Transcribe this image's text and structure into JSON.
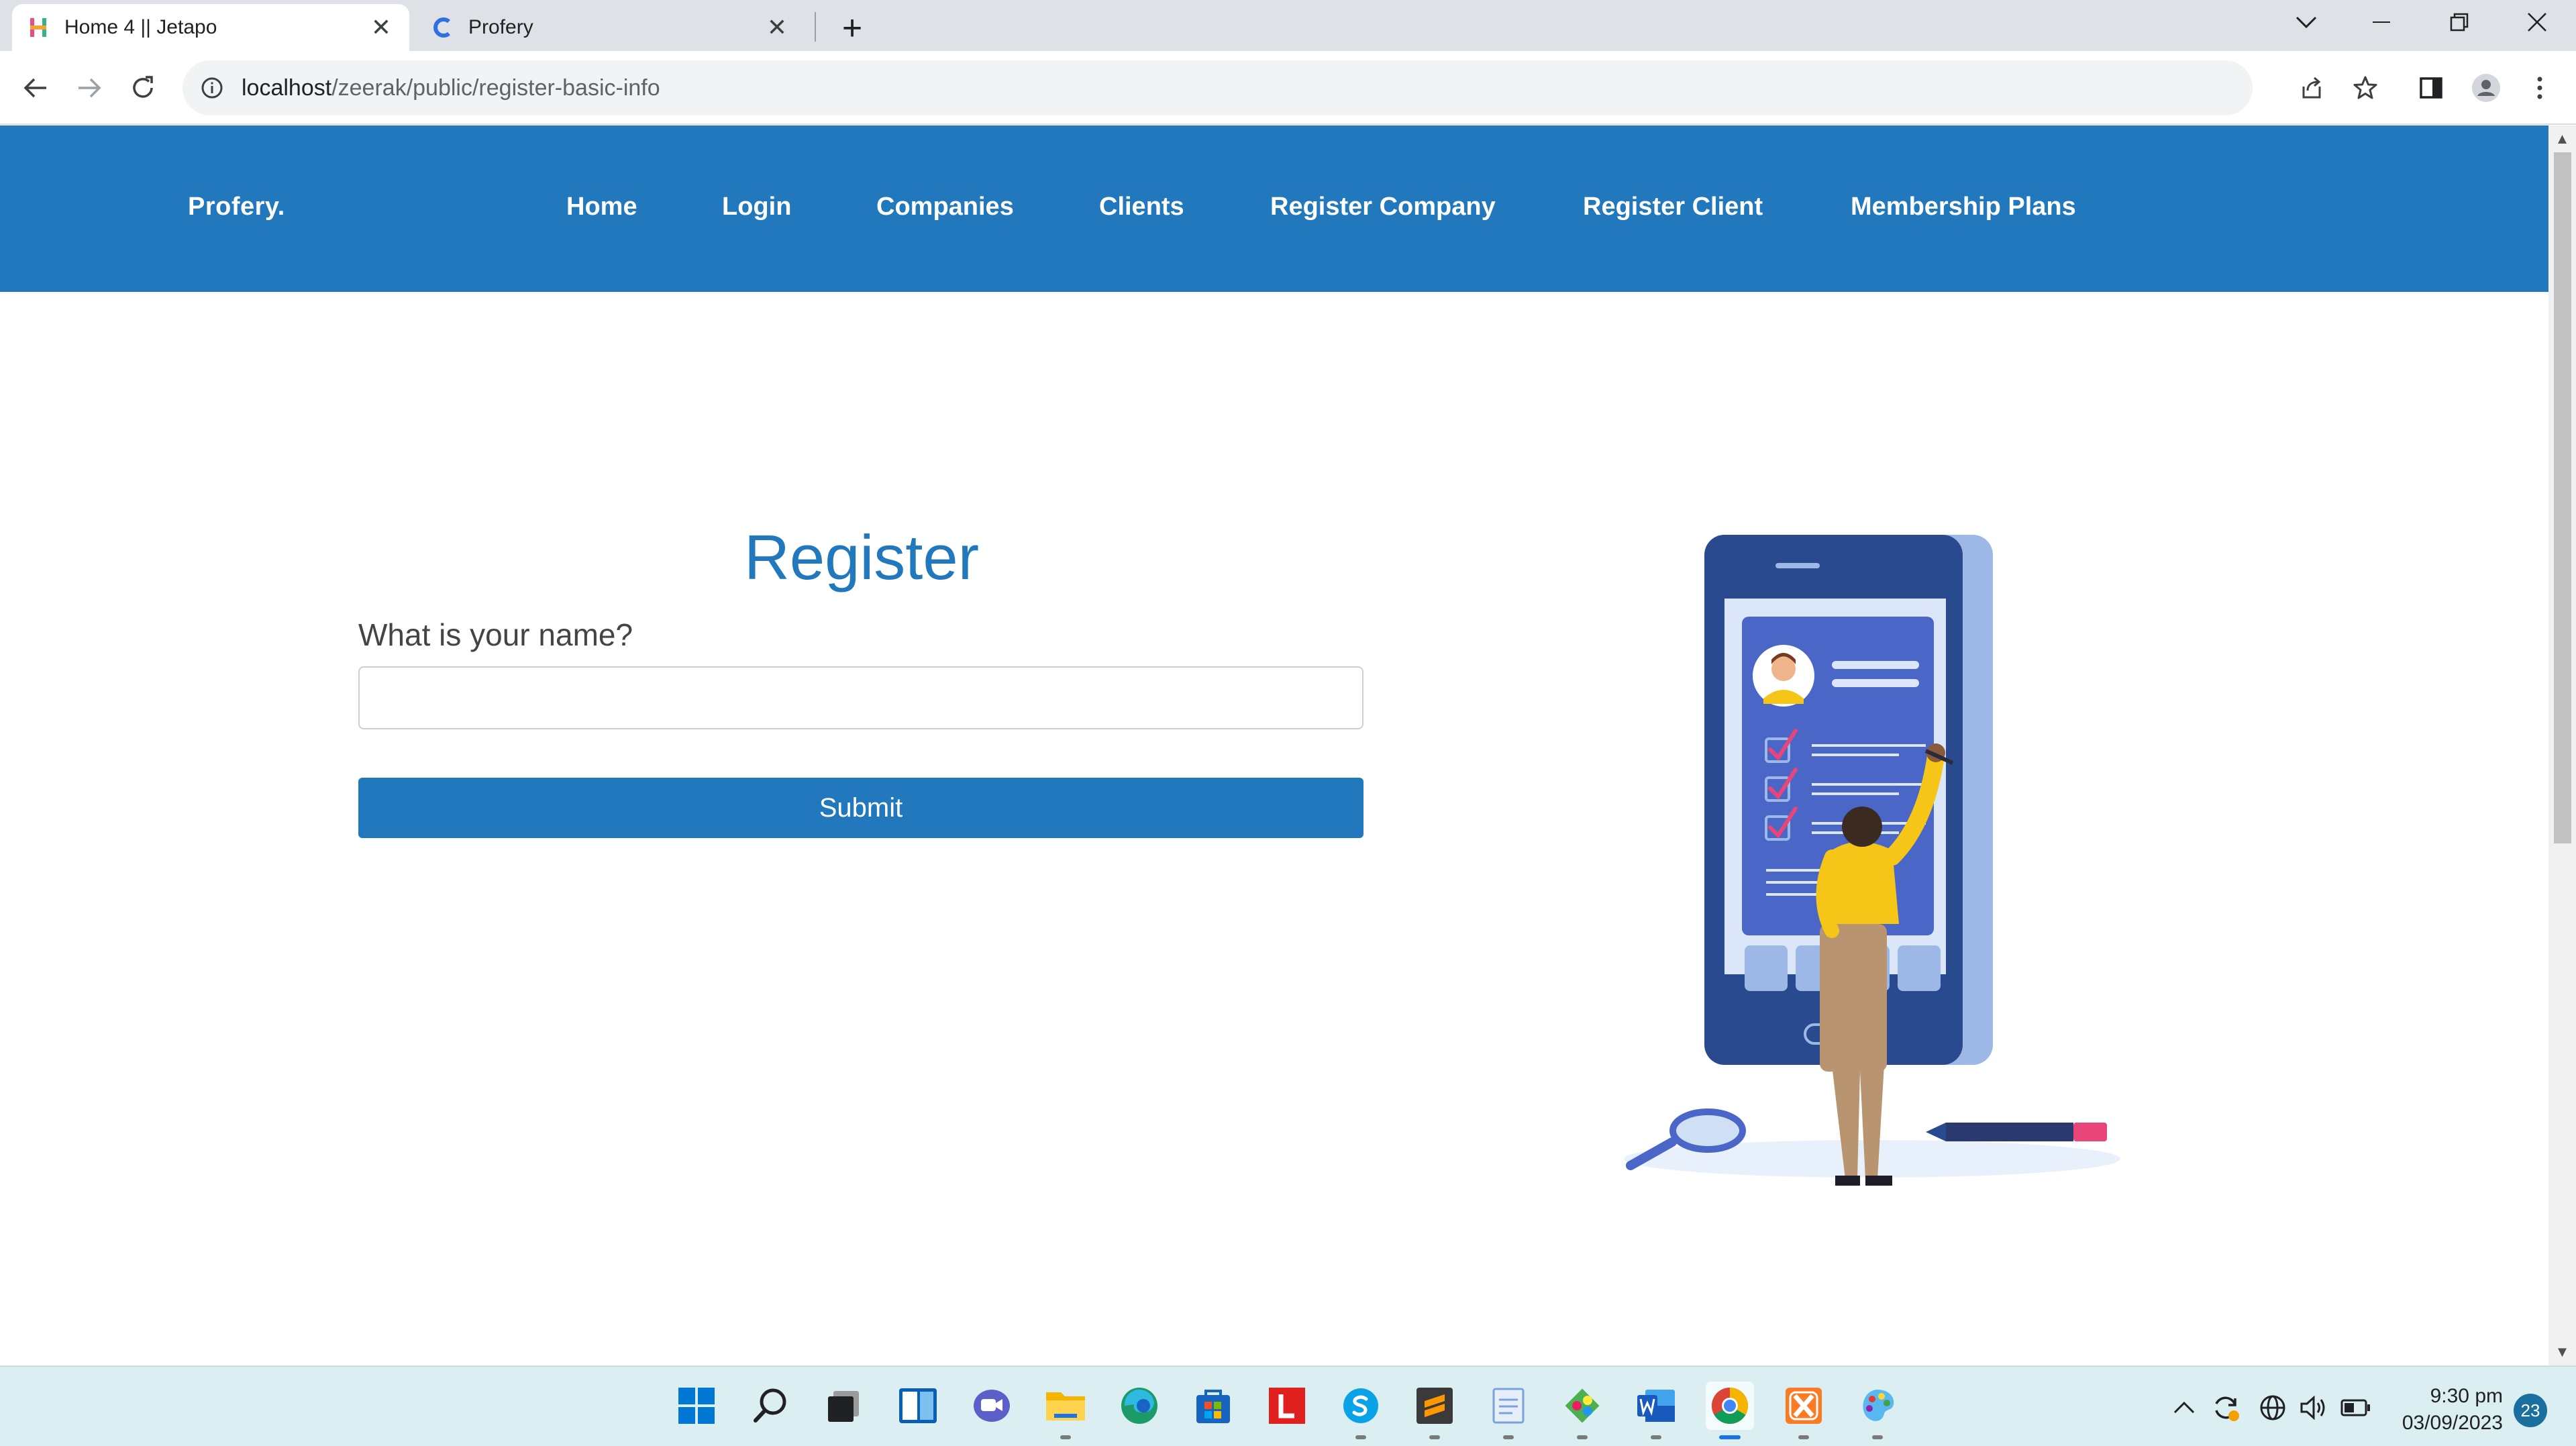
{
  "browser": {
    "tabs": [
      {
        "title": "Home 4 || Jetapo",
        "favicon": "jetapo-h-icon",
        "active": true
      },
      {
        "title": "Profery",
        "favicon": "profery-c-icon",
        "active": false
      }
    ],
    "new_tab_symbol": "+",
    "url_host": "localhost",
    "url_path": "/zeerak/public/register-basic-info"
  },
  "site": {
    "brand": "Profery.",
    "nav": [
      "Home",
      "Login",
      "Companies",
      "Clients",
      "Register Company",
      "Register Client",
      "Membership Plans"
    ],
    "colors": {
      "primary": "#2178bd",
      "accent_yellow": "#f5c518",
      "accent_pink": "#e8457a"
    }
  },
  "form": {
    "title": "Register",
    "name_label": "What is your name?",
    "name_value": "",
    "submit_label": "Submit"
  },
  "taskbar": {
    "apps": [
      "windows-start-icon",
      "search-icon",
      "task-view-icon",
      "widgets-icon",
      "teams-chat-icon",
      "file-explorer-icon",
      "edge-icon",
      "store-icon",
      "red-l-app-icon",
      "skype-icon",
      "sublime-text-icon",
      "notepad-icon",
      "git-icon",
      "word-icon",
      "chrome-icon",
      "xampp-icon",
      "paint-icon"
    ],
    "time": "9:30 pm",
    "date": "03/09/2023",
    "notifications": "23"
  }
}
